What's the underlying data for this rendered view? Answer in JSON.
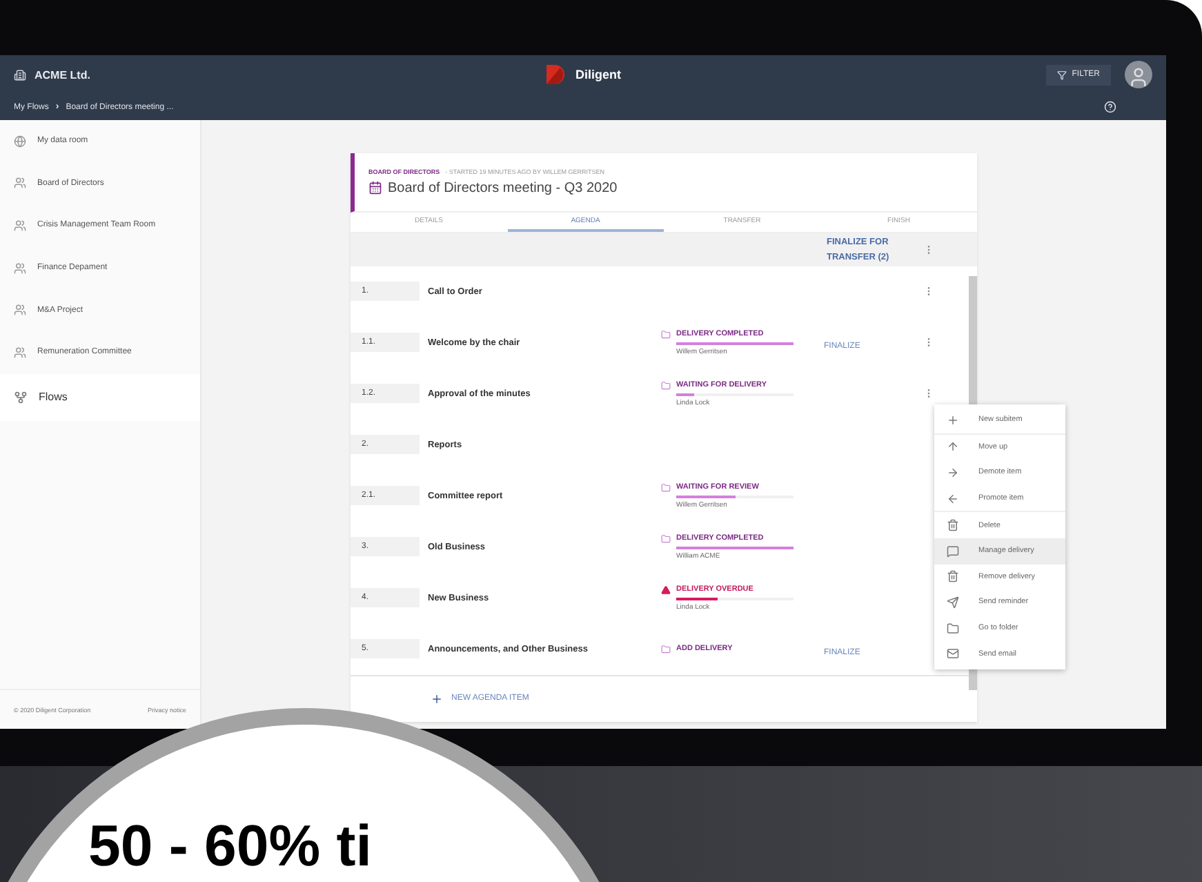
{
  "company": "ACME Ltd.",
  "brand": "Diligent",
  "filter_button": "FILTER",
  "breadcrumb": [
    "My Flows",
    "›",
    "Board of Directors meeting ..."
  ],
  "sidebar": {
    "items": [
      {
        "label": "My data room",
        "kind": "globe",
        "selected": false
      },
      {
        "label": "Board of Directors",
        "kind": "group",
        "selected": false
      },
      {
        "label": "Crisis Management Team Room",
        "kind": "group",
        "selected": false
      },
      {
        "label": "Finance Depament",
        "kind": "group",
        "selected": false
      },
      {
        "label": "M&A Project",
        "kind": "group",
        "selected": false
      },
      {
        "label": "Remuneration Committee",
        "kind": "group",
        "selected": false
      },
      {
        "label": "Flows",
        "kind": "flows",
        "selected": true
      }
    ],
    "footer": [
      "© 2020 Diligent Corporation",
      "Privacy notice"
    ]
  },
  "meeting": {
    "group": "BOARD OF DIRECTORS",
    "started": "- STARTED 19 MINUTES AGO BY WILLEM GERRITSEN",
    "title": "Board of Directors meeting - Q3 2020"
  },
  "tabs": [
    {
      "label": "DETAILS",
      "selected": false
    },
    {
      "label": "AGENDA",
      "selected": true
    },
    {
      "label": "TRANSFER",
      "selected": false
    },
    {
      "label": "FINISH",
      "selected": false
    }
  ],
  "table": {
    "header_action": "FINALIZE FOR TRANSFER (2)",
    "rows": [
      {
        "number": "1.",
        "title": "Call to Order",
        "kebab": true
      },
      {
        "number": "1.1.",
        "title": "Welcome by the chair",
        "status": {
          "kind": "folder",
          "label": "DELIVERY COMPLETED",
          "level": 1,
          "assignee": "Willem Gerritsen"
        },
        "action": "FINALIZE",
        "kebab": true
      },
      {
        "number": "1.2.",
        "title": "Approval of the minutes",
        "status": {
          "kind": "folder",
          "label": "WAITING FOR DELIVERY",
          "level": 0.15,
          "assignee": "Linda Lock"
        },
        "kebab": true
      },
      {
        "number": "2.",
        "title": "Reports",
        "kebab": false
      },
      {
        "number": "2.1.",
        "title": "Committee report",
        "status": {
          "kind": "folder",
          "label": "WAITING FOR REVIEW",
          "level": 0.5,
          "assignee": "Willem Gerritsen"
        },
        "kebab": false
      },
      {
        "number": "3.",
        "title": "Old Business",
        "status": {
          "kind": "folder",
          "label": "DELIVERY COMPLETED",
          "level": 1,
          "assignee": "William ACME"
        },
        "kebab": false
      },
      {
        "number": "4.",
        "title": "New Business",
        "status": {
          "kind": "overdue",
          "label": "DELIVERY OVERDUE",
          "level": 0.35,
          "assignee": "Linda Lock"
        },
        "kebab": false
      },
      {
        "number": "5.",
        "title": "Announcements, and Other Business",
        "status": {
          "kind": "add",
          "label": "ADD DELIVERY"
        },
        "action": "FINALIZE",
        "kebab": false
      }
    ]
  },
  "add_item": "NEW AGENDA ITEM",
  "context_menu": [
    {
      "label": "New subitem",
      "kind": "plus",
      "selected": false,
      "divider_before": false
    },
    {
      "label": "Move up",
      "kind": "up",
      "selected": false,
      "divider_before": true
    },
    {
      "label": "Demote item",
      "kind": "right",
      "selected": false,
      "divider_before": false
    },
    {
      "label": "Promote item",
      "kind": "left",
      "selected": false,
      "divider_before": false
    },
    {
      "label": "Delete",
      "kind": "trash",
      "selected": false,
      "divider_before": true
    },
    {
      "label": "Manage delivery",
      "kind": "message",
      "selected": true,
      "divider_before": false
    },
    {
      "label": "Remove delivery",
      "kind": "trash",
      "selected": false,
      "divider_before": false
    },
    {
      "label": "Send reminder",
      "kind": "send",
      "selected": false,
      "divider_before": false
    },
    {
      "label": "Go to folder",
      "kind": "folder",
      "selected": false,
      "divider_before": false
    },
    {
      "label": "Send email",
      "kind": "mail",
      "selected": false,
      "divider_before": false
    }
  ],
  "promo": "50 - 60% ti"
}
